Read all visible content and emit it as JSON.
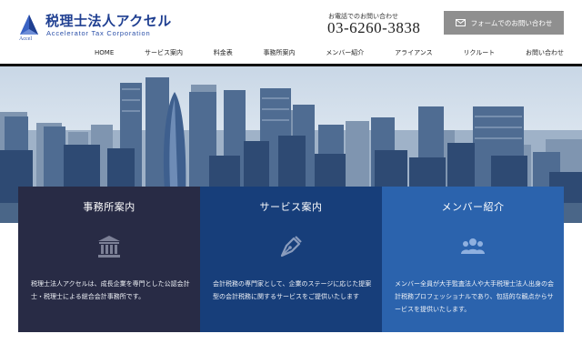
{
  "header": {
    "logo_mark_text": "Accel",
    "logo_title": "税理士法人アクセル",
    "logo_subtitle": "Accelerator Tax Corporation",
    "phone_label": "お電話でのお問い合わせ",
    "phone_number": "03-6260-3838",
    "contact_button": "フォームでのお問い合わせ"
  },
  "nav": {
    "items": [
      {
        "label": "HOME"
      },
      {
        "label": "サービス案内"
      },
      {
        "label": "料金表"
      },
      {
        "label": "事務所案内"
      },
      {
        "label": "メンバー紹介"
      },
      {
        "label": "アライアンス"
      },
      {
        "label": "リクルート"
      },
      {
        "label": "お問い合わせ"
      }
    ]
  },
  "cards": [
    {
      "title": "事務所案内",
      "icon": "building-icon",
      "text": "税理士法人アクセルは、成長企業を専門とした公認会計士・税理士による総合会計事務所です。"
    },
    {
      "title": "サービス案内",
      "icon": "pen-nib-icon",
      "text": "会計税務の専門家として、企業のステージに応じた提案型の会計税務に関するサービスをご提供いたします"
    },
    {
      "title": "メンバー紹介",
      "icon": "users-icon",
      "text": "メンバー全員が大手監査法人や大手税理士法人出身の会計税務プロフェッショナルであり、包括的な観点からサービスを提供いたします。"
    }
  ],
  "colors": {
    "brand": "#1f3f91",
    "card_1": "#282b45",
    "card_2": "#173e7a",
    "card_3": "#2b63ad",
    "contact_button": "#8f8f8f"
  }
}
